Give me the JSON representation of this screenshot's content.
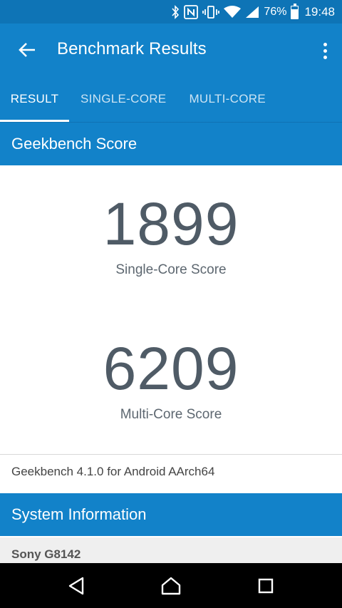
{
  "status_bar": {
    "battery_percent": "76%",
    "battery_level": 0.76,
    "time": "19:48",
    "icons": [
      "bluetooth-icon",
      "nfc-icon",
      "vibrate-icon",
      "wifi-icon",
      "signal-icon",
      "battery-icon"
    ]
  },
  "app_bar": {
    "title": "Benchmark Results",
    "back_icon": "arrow-back-icon",
    "menu_icon": "more-vert-icon"
  },
  "tabs": [
    {
      "label": "RESULT",
      "active": true
    },
    {
      "label": "SINGLE-CORE",
      "active": false
    },
    {
      "label": "MULTI-CORE",
      "active": false
    }
  ],
  "geekbench_section": {
    "header": "Geekbench Score",
    "single_core": {
      "value": "1899",
      "label": "Single-Core Score"
    },
    "multi_core": {
      "value": "6209",
      "label": "Multi-Core Score"
    },
    "version": "Geekbench 4.1.0 for Android AArch64"
  },
  "system_section": {
    "header": "System Information",
    "device": "Sony G8142"
  },
  "nav_bar": {
    "icons": [
      "back-triangle-icon",
      "home-icon",
      "recents-square-icon"
    ]
  },
  "colors": {
    "status_bar": "#0e74b6",
    "primary": "#1282c9",
    "score_text": "#4f5b66"
  }
}
